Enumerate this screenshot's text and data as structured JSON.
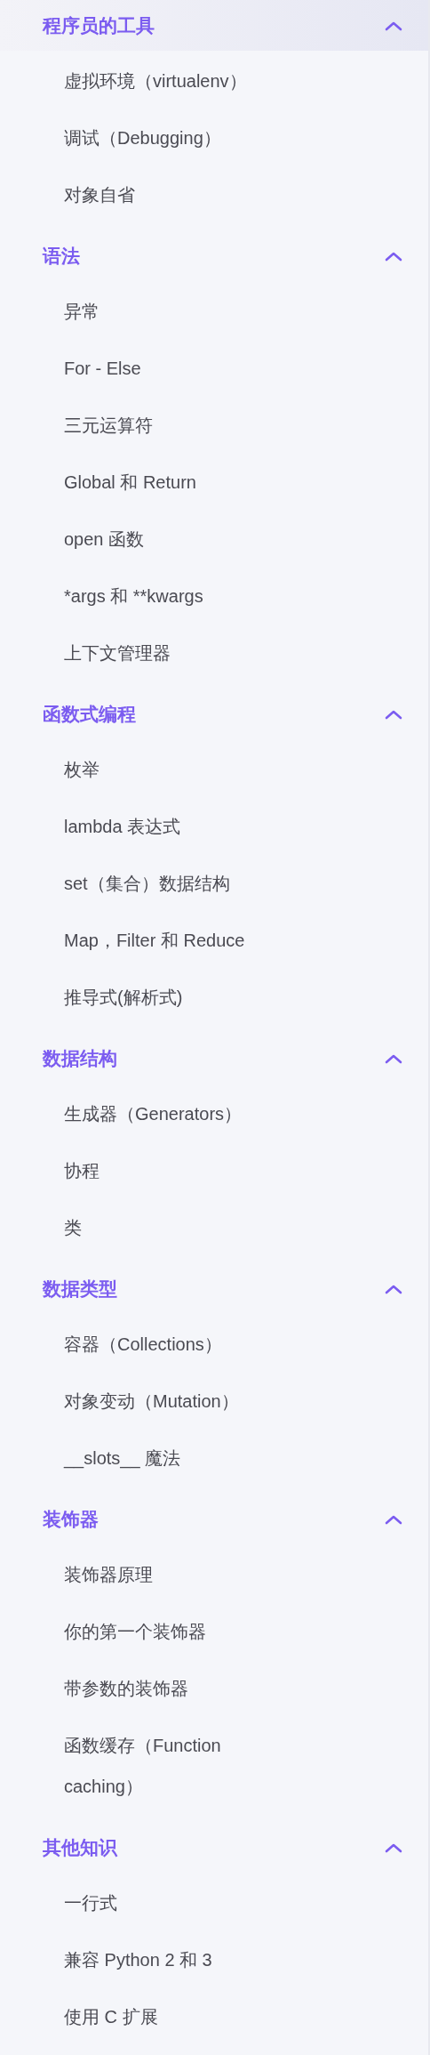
{
  "sidebar": {
    "sections": [
      {
        "title": "程序员的工具",
        "expanded": true,
        "selected": true,
        "items": [
          "虚拟环境（virtualenv）",
          "调试（Debugging）",
          "对象自省"
        ]
      },
      {
        "title": "语法",
        "expanded": true,
        "selected": false,
        "items": [
          "异常",
          "For - Else",
          "三元运算符",
          "Global 和 Return",
          "open 函数",
          "*args 和 **kwargs",
          "上下文管理器"
        ]
      },
      {
        "title": "函数式编程",
        "expanded": true,
        "selected": false,
        "items": [
          "枚举",
          "lambda 表达式",
          "set（集合）数据结构",
          "Map，Filter 和 Reduce",
          "推导式(解析式)"
        ]
      },
      {
        "title": "数据结构",
        "expanded": true,
        "selected": false,
        "items": [
          "生成器（Generators）",
          "协程",
          "类"
        ]
      },
      {
        "title": "数据类型",
        "expanded": true,
        "selected": false,
        "items": [
          "容器（Collections）",
          "对象变动（Mutation）",
          "__slots__ 魔法"
        ]
      },
      {
        "title": "装饰器",
        "expanded": true,
        "selected": false,
        "items": [
          "装饰器原理",
          "你的第一个装饰器",
          "带参数的装饰器",
          "函数缓存（Function caching）"
        ]
      },
      {
        "title": "其他知识",
        "expanded": true,
        "selected": false,
        "items": [
          "一行式",
          "兼容 Python 2 和 3",
          "使用 C 扩展"
        ]
      }
    ]
  }
}
